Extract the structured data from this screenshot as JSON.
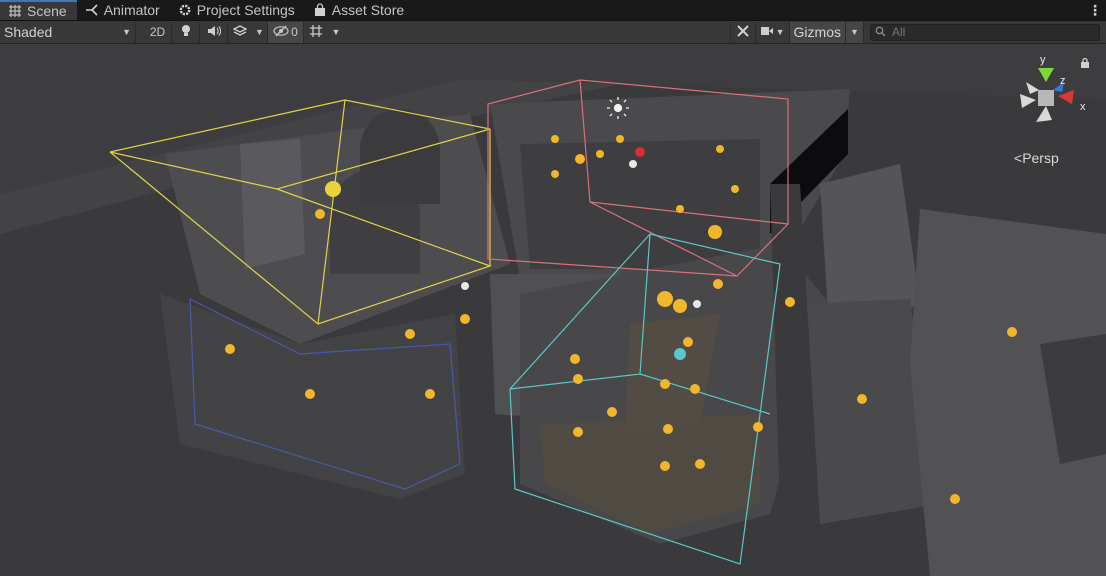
{
  "tabs": [
    {
      "label": "Scene",
      "icon": "grid-icon",
      "active": true
    },
    {
      "label": "Animator",
      "icon": "animator-icon",
      "active": false
    },
    {
      "label": "Project Settings",
      "icon": "gear-icon",
      "active": false
    },
    {
      "label": "Asset Store",
      "icon": "shopping-bag-icon",
      "active": false
    }
  ],
  "toolbar": {
    "shading_mode": "Shaded",
    "mode_2d_label": "2D",
    "hidden_count": "0",
    "gizmos_label": "Gizmos",
    "search_placeholder": "All"
  },
  "viewport": {
    "projection_label": "Persp",
    "axis_labels": {
      "x": "x",
      "y": "y",
      "z": "z"
    }
  },
  "colors": {
    "accent": "#3a79bb",
    "selection_yellow": "#e0d24a",
    "volume_red": "#d8707a",
    "volume_cyan": "#58c8c8",
    "volume_blue": "#4a5aa8",
    "axis_x": "#d83a3a",
    "axis_y": "#7ad83a",
    "axis_z": "#3a78d8"
  }
}
